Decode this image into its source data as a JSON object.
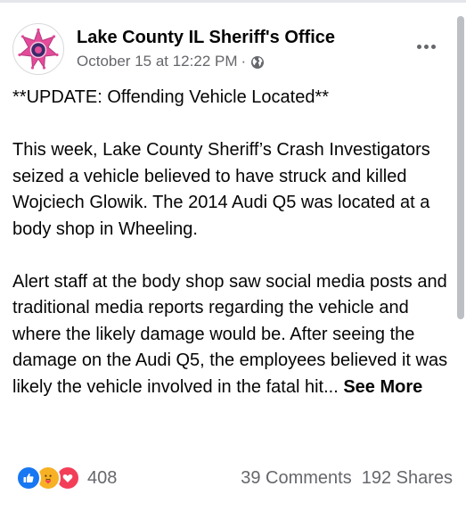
{
  "post": {
    "page_name": "Lake County IL Sheriff's Office",
    "timestamp": "October 15 at 12:22 PM",
    "separator": "·",
    "audience_icon": "globe-icon",
    "more_icon": "more-options-icon",
    "paragraphs": [
      "**UPDATE: Offending Vehicle Located**",
      "This week, Lake County Sheriff’s Crash Investigators seized a vehicle believed to have struck and killed Wojciech Glowik. The 2014 Audi Q5 was located at a body shop in Wheeling.",
      "Alert staff at the body shop saw social media posts and traditional media reports regarding the vehicle and where the likely damage would be. After seeing the damage on the Audi Q5, the employees believed it was likely the vehicle involved in the fatal hit..."
    ],
    "see_more": "See More"
  },
  "footer": {
    "reactions": [
      "like-icon",
      "care-icon",
      "love-icon"
    ],
    "reaction_count": "408",
    "comments": "39 Comments",
    "shares": "192 Shares"
  },
  "colors": {
    "like": "#1877f2",
    "care": "#f7b125",
    "love": "#f33e58",
    "badge": "#e44b9a",
    "secondary_text": "#65676b"
  }
}
